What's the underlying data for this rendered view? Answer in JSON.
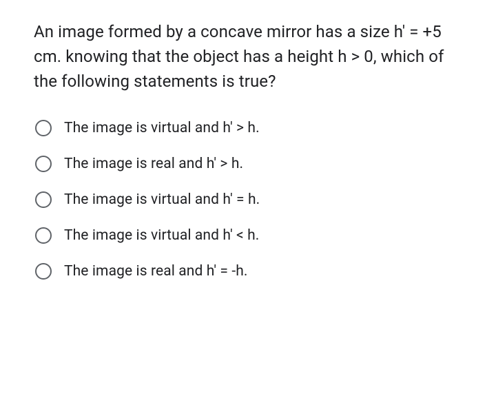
{
  "question": "An image formed by a concave mirror has a size h' = +5 cm. knowing that the object has a height h > 0, which of the following statements is true?",
  "options": [
    {
      "label": "The image is virtual and h' > h."
    },
    {
      "label": "The image is real and h' > h."
    },
    {
      "label": "The image is virtual and h' = h."
    },
    {
      "label": "The image is virtual and h' < h."
    },
    {
      "label": "The image is real and h' = -h."
    }
  ]
}
